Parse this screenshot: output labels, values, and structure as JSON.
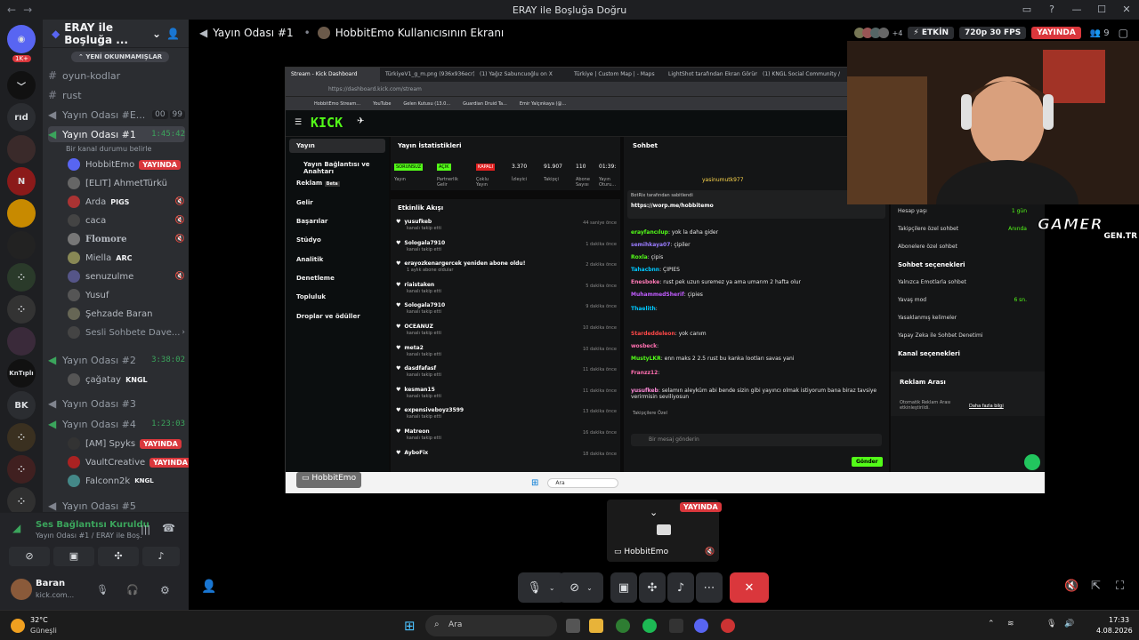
{
  "app": {
    "window_title": "ERAY ile Boşluğa Doğru",
    "server_name": "ERAY ile Boşluğa ...",
    "back": "←",
    "forward": "→",
    "controls": [
      "—",
      "☐",
      "✕"
    ],
    "guild_badge": "1K+",
    "guild_labels": [
      "rıd",
      "KnTıplı",
      "BK"
    ]
  },
  "channels": {
    "new_unreads": "YENİ OKUNMAMIŞLAR",
    "items": [
      {
        "name": "oyun-kodlar",
        "type": "text"
      },
      {
        "name": "rust",
        "type": "text"
      }
    ],
    "voice": [
      {
        "name": "Yayın Odası #E...",
        "counts": [
          "00",
          "99"
        ]
      },
      {
        "name": "Yayın Odası #1",
        "timer": "1:45:42",
        "status": "Bir kanal durumu belirle"
      },
      {
        "name": "Yayın Odası #2",
        "timer": "3:38:02"
      },
      {
        "name": "Yayın Odası #3"
      },
      {
        "name": "Yayın Odası #4",
        "timer": "1:23:03"
      },
      {
        "name": "Yayın Odası #5"
      }
    ],
    "users1": [
      {
        "name": "HobbitEmo",
        "live": "YAYINDA"
      },
      {
        "name": "[ELIT] AhmetTürkü"
      },
      {
        "name": "Arda",
        "tag": "PIGS"
      },
      {
        "name": "caca"
      },
      {
        "name": "Flomore"
      },
      {
        "name": "Miella",
        "tag": "ARC"
      },
      {
        "name": "senuzulme"
      },
      {
        "name": "Yusuf"
      },
      {
        "name": "Şehzade Baran"
      },
      {
        "name": "Sesli Sohbete Dave..."
      }
    ],
    "users2": [
      {
        "name": "çağatay",
        "tag": "KNGL"
      }
    ],
    "users4": [
      {
        "name": "[AM] Spyks",
        "live": "YAYINDA"
      },
      {
        "name": "VaultCreative",
        "live": "YAYINDA"
      },
      {
        "name": "Falconn2k",
        "tag": "KNGL"
      }
    ]
  },
  "voice_panel": {
    "status": "Ses Bağlantısı Kuruldu",
    "channel": "Yayın Odası #1 / ERAY ile Boş...",
    "user": "Baran",
    "user_sub": "kick.com..."
  },
  "stage": {
    "channel": "Yayın Odası #1",
    "screen_of": "HobbitEmo Kullanıcısının Ekranı",
    "viewer_count": "+4",
    "activity": "ETKİN",
    "quality": "720p 30 FPS",
    "live": "YAYINDA",
    "people_count": "9",
    "overlay_name": "HobbitEmo",
    "mini_name": "HobbitEmo",
    "mini_live": "YAYINDA"
  },
  "browser": {
    "tabs": [
      "Stream - Kick Dashboard",
      "TürkiyeV1_g_m.png (936x936ecr)",
      "(1) Yağız Sabuncuoğlu on X",
      "Türkiye | Custom Map | - Maps",
      "LightShot tarafından Ekran Görünt",
      "(1) KNGL Social Community /"
    ],
    "url": "https://dashboard.kick.com/stream",
    "bookmarks": [
      "HobbitEmo Stream...",
      "YouTube",
      "Gelen Kutusu (13.0...",
      "Guardian Druid Ta...",
      "Emir Yalçınkaya (@..."
    ]
  },
  "kick": {
    "logo": "KICK",
    "nav": [
      "Yayın",
      "Yayın Bağlantısı ve Anahtarı",
      "Reklam",
      "Gelir",
      "Başarılar",
      "Stüdyo",
      "Analitik",
      "Denetleme",
      "Topluluk",
      "Droplar ve ödüller"
    ],
    "beta": "Beta",
    "stats_title": "Yayın İstatistikleri",
    "stats": [
      {
        "value": "SORUNSUZ",
        "label": "Yayın"
      },
      {
        "value": "AÇIK",
        "label": "Partnerlik Gelir"
      },
      {
        "value": "KAPALI",
        "label": "Çoklu Yayın"
      },
      {
        "value": "3.370",
        "label": "İzleyici"
      },
      {
        "value": "91.907",
        "label": "Takipçi"
      },
      {
        "value": "110",
        "label": "Abone Sayısı"
      },
      {
        "value": "01:39:",
        "label": "Yayın Oturu..."
      }
    ],
    "activity_title": "Etkinlik Akışı",
    "activity": [
      {
        "name": "yusufkeb",
        "sub": "kanalı takip etti",
        "time": "44 saniye önce"
      },
      {
        "name": "Sologala7910",
        "sub": "kanalı takip etti",
        "time": "1 dakika önce"
      },
      {
        "name": "erayozkenargercek yeniden abone oldu!",
        "sub": "1 aylık abone oldular",
        "time": "2 dakika önce"
      },
      {
        "name": "riaistaken",
        "sub": "kanalı takip etti",
        "time": "5 dakika önce"
      },
      {
        "name": "Sologala7910",
        "sub": "kanalı takip etti",
        "time": "9 dakika önce"
      },
      {
        "name": "OCEANUZ",
        "sub": "kanalı takip etti",
        "time": "10 dakika önce"
      },
      {
        "name": "meta2",
        "sub": "kanalı takip etti",
        "time": "10 dakika önce"
      },
      {
        "name": "dasdfafasf",
        "sub": "kanalı takip etti",
        "time": "11 dakika önce"
      },
      {
        "name": "kesman15",
        "sub": "kanalı takip etti",
        "time": "11 dakika önce"
      },
      {
        "name": "expensiveboyz3599",
        "sub": "kanalı takip etti",
        "time": "13 dakika önce"
      },
      {
        "name": "Matreon",
        "sub": "kanalı takip etti",
        "time": "16 dakika önce"
      },
      {
        "name": "AyboFix",
        "sub": "",
        "time": "18 dakika önce"
      }
    ],
    "chat_title": "Sohbet",
    "pinned_user": "yasinumutk977",
    "pinned_by": "BotRix tarafından sabitlendi",
    "pinned_link": "https://worp.me/hobbitemo",
    "chat": [
      {
        "user": "erayfancılup",
        "text": "yok la daha gider",
        "color": "#53fc18"
      },
      {
        "user": "semihkaya07",
        "text": "çipiler",
        "color": "#9a7cff"
      },
      {
        "user": "Roxla",
        "text": "çipis",
        "color": "#53fc18"
      },
      {
        "user": "Tahacbnn",
        "text": "ÇİPİES",
        "color": "#00c8ff"
      },
      {
        "user": "Enesboke",
        "text": "rust pek uzun suremez ya ama umarım 2 hafta olur",
        "color": "#ff7ab6"
      },
      {
        "user": "MuhammedSherif",
        "text": "çipies",
        "color": "#c15cff"
      },
      {
        "user": "Thaelith",
        "text": "",
        "color": "#00c8ff"
      },
      {
        "user": "Stardeddeleon",
        "text": "yok canım",
        "color": "#ff4848"
      },
      {
        "user": "wosbeck",
        "text": "",
        "color": "#ff6fb0"
      },
      {
        "user": "MustyLKR",
        "text": "enn maks 2 2.5 rust bu kanka lootları savas yani",
        "color": "#53fc18"
      },
      {
        "user": "Franzz12",
        "text": "",
        "color": "#ff6fb0"
      },
      {
        "user": "yusufkeb",
        "text": "selamın aleyküm abi bende sizin gibi yayıncı olmak istiyorum bana biraz tavsiye verirmisin seviliyosun",
        "color": "#ff8ad8"
      }
    ],
    "chat_placeholder": "Bir mesaj gönderin",
    "send": "Gönder",
    "follower_label": "Takipçilere Özel",
    "settings": [
      {
        "label": "Sohbet erişimi",
        "value": "",
        "header": true
      },
      {
        "label": "Hesap yaşı",
        "value": "1 gün"
      },
      {
        "label": "Takipçilere özel sohbet",
        "value": "Anında"
      },
      {
        "label": "Abonelere özel sohbet",
        "value": ""
      },
      {
        "label": "Sohbet seçenekleri",
        "value": "",
        "header": true
      },
      {
        "label": "Yalnızca Emotlarla sohbet",
        "value": ""
      },
      {
        "label": "Yavaş mod",
        "value": "6 sn."
      },
      {
        "label": "Yasaklanmış kelimeler",
        "value": ""
      },
      {
        "label": "Yapay Zeka ile Sohbet Denetimi",
        "value": ""
      },
      {
        "label": "Kanal seçenekleri",
        "value": "",
        "header": true
      }
    ],
    "ads_title": "Reklam Arası",
    "ads_text": "Otomatik Reklam Arası etkinleştirildi.",
    "ads_link": "Daha fazla bilgi"
  },
  "inner_taskbar": {
    "search": "Ara"
  },
  "watermark": {
    "line1": "GAMER",
    "line2": "GEN.TR"
  },
  "controls": {
    "end_call": "✕"
  },
  "taskbar": {
    "weather_temp": "32°C",
    "weather_text": "Güneşli",
    "search": "Ara",
    "time": "17:33",
    "date": "4.08.2026"
  }
}
